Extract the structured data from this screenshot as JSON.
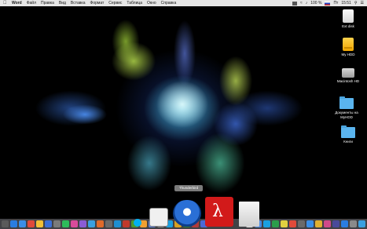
{
  "menubar": {
    "app": "Word",
    "items": [
      "Файл",
      "Правка",
      "Вид",
      "Вставка",
      "Формат",
      "Сервис",
      "Таблица",
      "Окно",
      "Справка"
    ],
    "battery": "100 %",
    "day": "Пт",
    "time": "15:51"
  },
  "desktop": {
    "icons": [
      {
        "label": "Ext disk",
        "icon": "external-disk-icon"
      },
      {
        "label": "My HDD",
        "icon": "external-hdd-icon"
      },
      {
        "label": "Macintosh HD",
        "icon": "internal-hd-icon"
      },
      {
        "label": "Документы на MyHDD",
        "icon": "folder-icon"
      },
      {
        "label": "Книги",
        "icon": "folder-icon"
      }
    ]
  },
  "dock": {
    "tooltip": "Thunderbird",
    "colors": [
      "#5a5a5a",
      "#2a7de1",
      "#3a8ee6",
      "#e04a3a",
      "#f2c037",
      "#3b6fd6",
      "#7a7a7a",
      "#2dbb5a",
      "#d84b9a",
      "#8a5cd6",
      "#3aa0e0",
      "#e06a2a",
      "#6a6a6a",
      "#1f8fd1",
      "#c0392b",
      "#4c9a2a",
      "#f0a030",
      "#5a7fd6",
      "#8a8a8a",
      "#1aa0e0",
      "#d6a020",
      "#2d7d2d",
      "#b03a3a",
      "#4a6ad6"
    ],
    "right_colors": [
      "#dcdcdc",
      "#4a8ae0",
      "#1aa0e0",
      "#2a9d4a",
      "#e0d040",
      "#e04a3a",
      "#6a6a6a",
      "#3a8ee6",
      "#e0b030",
      "#d04a8a",
      "#4a4a9a",
      "#2a7de1",
      "#8a8a8a",
      "#3aa0e0"
    ]
  }
}
